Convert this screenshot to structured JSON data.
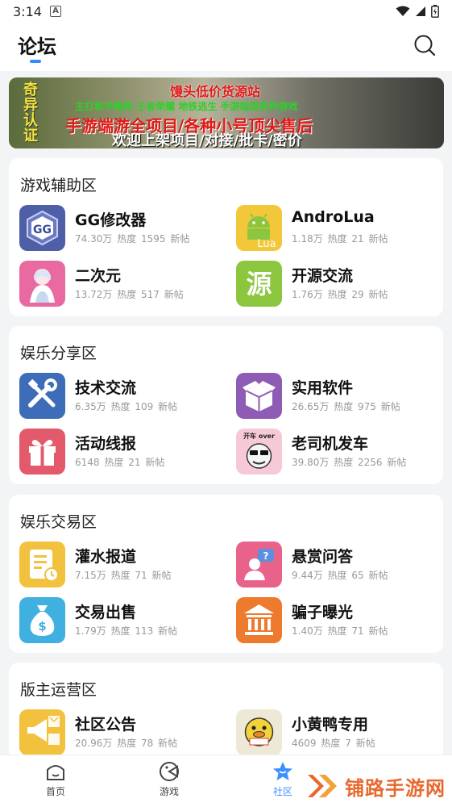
{
  "status_bar": {
    "time": "3:14",
    "notif_letter": "A"
  },
  "header": {
    "title": "论坛"
  },
  "banner": {
    "side_text": [
      "奇",
      "异",
      "认",
      "证"
    ],
    "line1": "馒头低价货源站",
    "line2": "主打和平精英 王者荣耀 地铁逃生 手游端游各种游戏",
    "line3": "手游端游全项目/各种小号顶尖售后",
    "line4": "欢迎上架项目/对接/批卡/密价"
  },
  "sections": [
    {
      "title": "游戏辅助区",
      "forums": [
        {
          "name": "GG修改器",
          "heat": "74.30万",
          "posts": "1595",
          "icon": "gg-icon"
        },
        {
          "name": "AndroLua",
          "heat": "1.18万",
          "posts": "21",
          "icon": "androlua-icon"
        },
        {
          "name": "二次元",
          "heat": "13.72万",
          "posts": "517",
          "icon": "anime-icon"
        },
        {
          "name": "开源交流",
          "heat": "1.76万",
          "posts": "29",
          "icon": "source-icon"
        }
      ]
    },
    {
      "title": "娱乐分享区",
      "forums": [
        {
          "name": "技术交流",
          "heat": "6.35万",
          "posts": "109",
          "icon": "tools-icon"
        },
        {
          "name": "实用软件",
          "heat": "26.65万",
          "posts": "975",
          "icon": "box-icon"
        },
        {
          "name": "活动线报",
          "heat": "6148",
          "posts": "21",
          "icon": "gift-icon"
        },
        {
          "name": "老司机发车",
          "heat": "39.80万",
          "posts": "2256",
          "icon": "driver-icon"
        }
      ]
    },
    {
      "title": "娱乐交易区",
      "forums": [
        {
          "name": "灌水报道",
          "heat": "7.15万",
          "posts": "71",
          "icon": "note-icon"
        },
        {
          "name": "悬赏问答",
          "heat": "9.44万",
          "posts": "65",
          "icon": "question-icon"
        },
        {
          "name": "交易出售",
          "heat": "1.79万",
          "posts": "113",
          "icon": "money-bag-icon"
        },
        {
          "name": "骗子曝光",
          "heat": "1.40万",
          "posts": "71",
          "icon": "bank-icon"
        }
      ]
    },
    {
      "title": "版主运营区",
      "forums": [
        {
          "name": "社区公告",
          "heat": "20.96万",
          "posts": "78",
          "icon": "megaphone-icon"
        },
        {
          "name": "小黄鸭专用",
          "heat": "4609",
          "posts": "7",
          "icon": "duck-icon"
        }
      ]
    }
  ],
  "labels": {
    "heat": "热度",
    "posts": "新帖"
  },
  "icon_text": {
    "source_char": "源",
    "lua": "Lua",
    "driver_text": "开车 over"
  },
  "bottom_nav": [
    {
      "label": "首页",
      "active": false
    },
    {
      "label": "游戏",
      "active": false
    },
    {
      "label": "社区",
      "active": true
    }
  ],
  "watermark": {
    "text": "铺路手游网"
  },
  "colors": {
    "accent": "#3a90ff",
    "watermark": "#e8692f"
  }
}
